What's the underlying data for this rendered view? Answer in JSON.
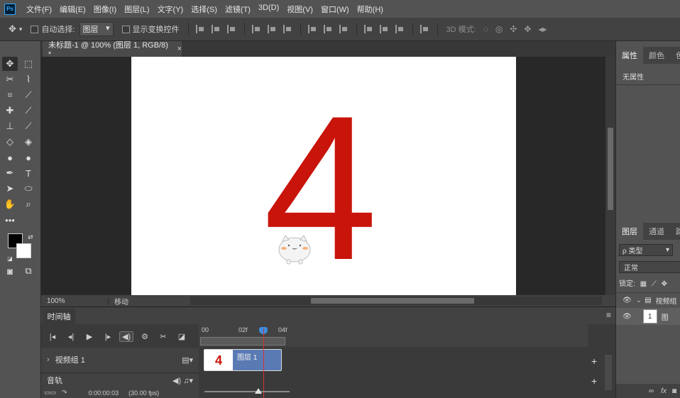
{
  "app": {
    "logo_text": "Ps"
  },
  "menu": [
    "文件(F)",
    "编辑(E)",
    "图像(I)",
    "图层(L)",
    "文字(Y)",
    "选择(S)",
    "滤镜(T)",
    "3D(D)",
    "视图(V)",
    "窗口(W)",
    "帮助(H)"
  ],
  "options": {
    "auto_select_label": "自动选择:",
    "auto_select_value": "图层",
    "show_transform_label": "显示变换控件",
    "mode3d_label": "3D 模式:"
  },
  "document": {
    "tab_title": "未标题-1 @ 100% (图层 1, RGB/8) *",
    "close_glyph": "×",
    "canvas_text": "4"
  },
  "status": {
    "zoom": "100%",
    "info": "移动"
  },
  "timeline": {
    "tab": "时间轴",
    "ruler_labels": [
      "00",
      "02f",
      "04f"
    ],
    "video_group": "视频组 1",
    "audio_track": "音轨",
    "clip_thumb_text": "4",
    "clip_name": "图层 1",
    "time_code": "0:00:00:03",
    "fps": "(30.00 fps)",
    "add_glyph": "+"
  },
  "panels": {
    "props_tabs": [
      "属性",
      "颜色",
      "色"
    ],
    "no_props": "无属性",
    "layers_tabs": [
      "图层",
      "通道",
      "路"
    ],
    "filter": "ρ 类型",
    "blend_mode": "正常",
    "lock_label": "锁定:",
    "layer_group_name": "视频组",
    "layer_1_name": "图",
    "layer_thumb_text": "1",
    "foot_label": "fx"
  },
  "colors": {
    "accent": "#31a8ff",
    "canvas_text": "#c8140a",
    "clip": "#5a7ab4",
    "playhead": "#d8322f"
  }
}
